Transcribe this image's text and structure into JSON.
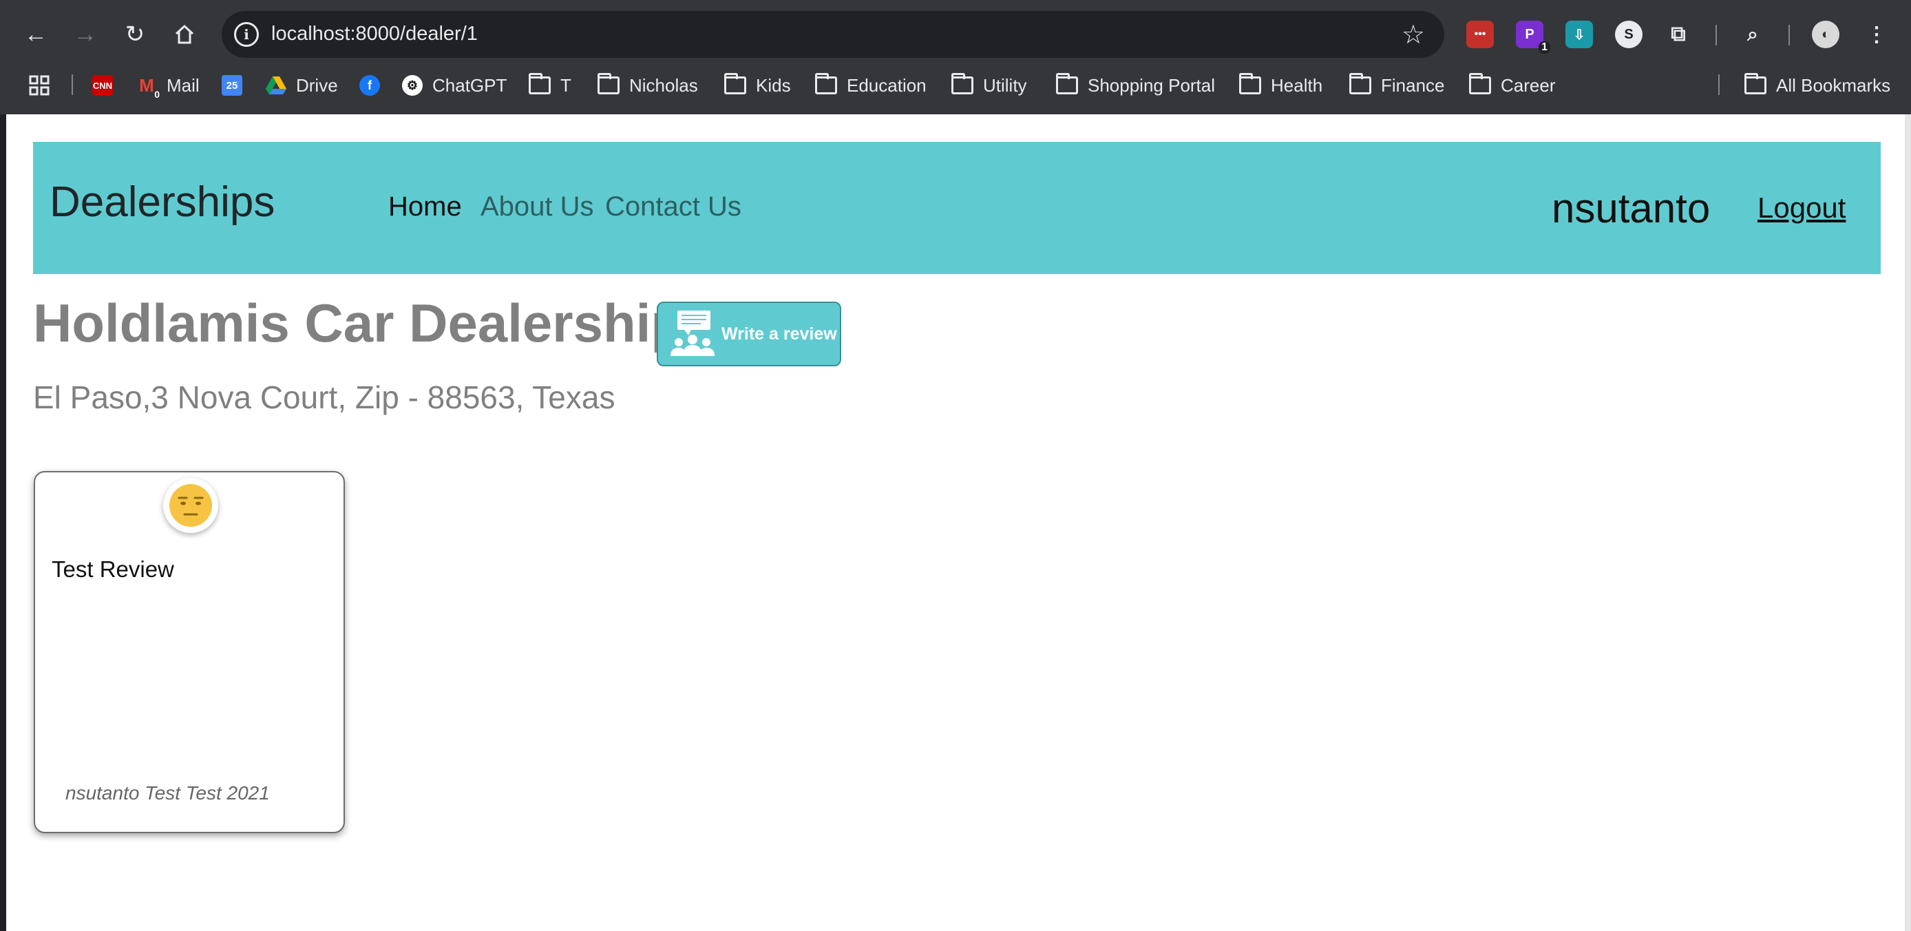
{
  "browser": {
    "url": "localhost:8000/dealer/1",
    "bookmarks": [
      {
        "label": "Mail",
        "icon": "gmail-icon"
      },
      {
        "label": "Drive",
        "icon": "google-drive-icon"
      },
      {
        "label": "ChatGPT",
        "icon": "chatgpt-icon"
      },
      {
        "label": "T",
        "icon": "folder-icon"
      },
      {
        "label": "Nicholas",
        "icon": "folder-icon"
      },
      {
        "label": "Kids",
        "icon": "folder-icon"
      },
      {
        "label": "Education",
        "icon": "folder-icon"
      },
      {
        "label": "Utility",
        "icon": "folder-icon"
      },
      {
        "label": "Shopping Portal",
        "icon": "folder-icon"
      },
      {
        "label": "Health",
        "icon": "folder-icon"
      },
      {
        "label": "Finance",
        "icon": "folder-icon"
      },
      {
        "label": "Career",
        "icon": "folder-icon"
      }
    ],
    "all_bookmarks": "All Bookmarks",
    "cnn_icon_text": "CNN",
    "calendar_icon_text": "25",
    "mail_badge": "0",
    "ext_badge": "1",
    "ext_p_text": "P",
    "ext_s_text": "S"
  },
  "navbar": {
    "brand": "Dealerships",
    "links": [
      "Home",
      "About Us",
      "Contact Us"
    ],
    "username": "nsutanto",
    "logout": "Logout",
    "color": "#5fcbd0"
  },
  "dealer": {
    "name": "Holdlamis Car Dealership",
    "write_review": "Write a review",
    "address": "El Paso,3 Nova Court, Zip - 88563, Texas"
  },
  "reviews": [
    {
      "sentiment_icon": "neutral-face-icon",
      "text": "Test Review",
      "author_line": "nsutanto Test Test 2021"
    }
  ]
}
